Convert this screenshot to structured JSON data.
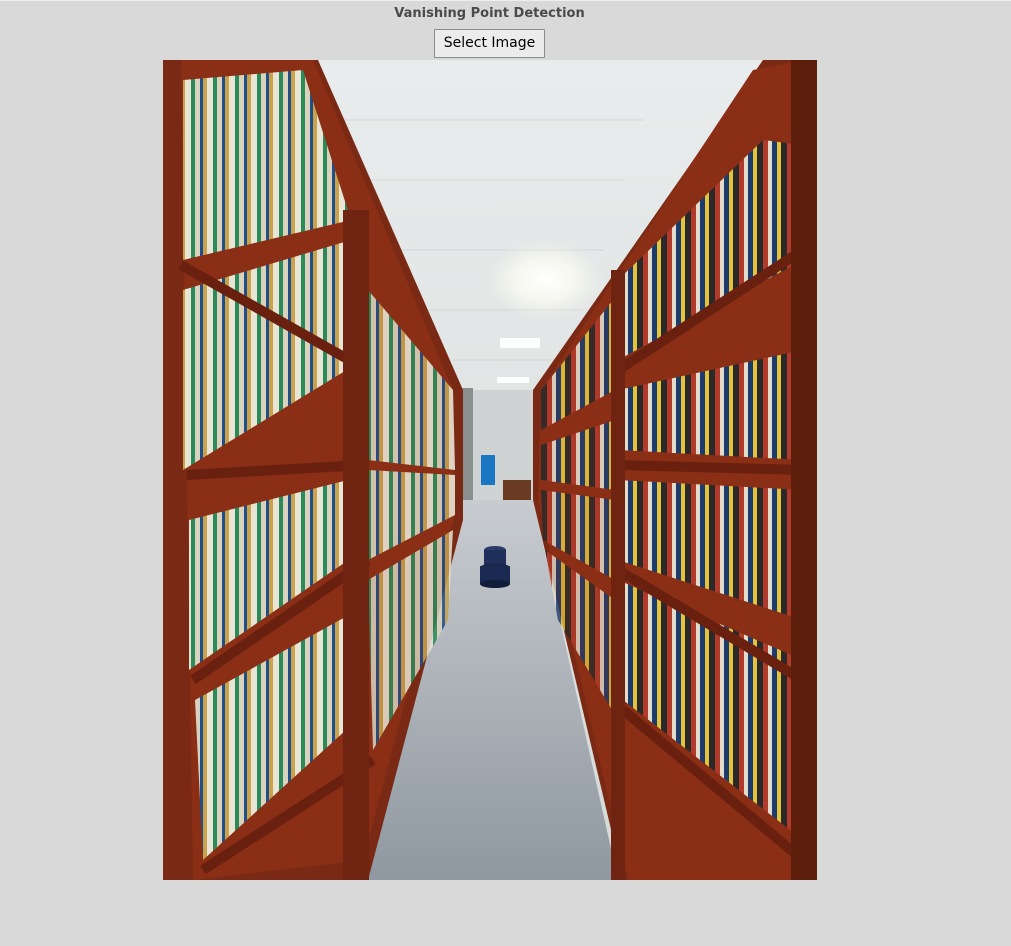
{
  "app": {
    "title": "Vanishing Point Detection"
  },
  "toolbar": {
    "select_label": "Select Image"
  },
  "photo": {
    "subject": "library-aisle",
    "colors": {
      "shelf_wood": "#8a2a12",
      "ceiling": "#e6e9e8",
      "carpet": "#9aa2aa",
      "stool": "#1e2f5a"
    }
  }
}
